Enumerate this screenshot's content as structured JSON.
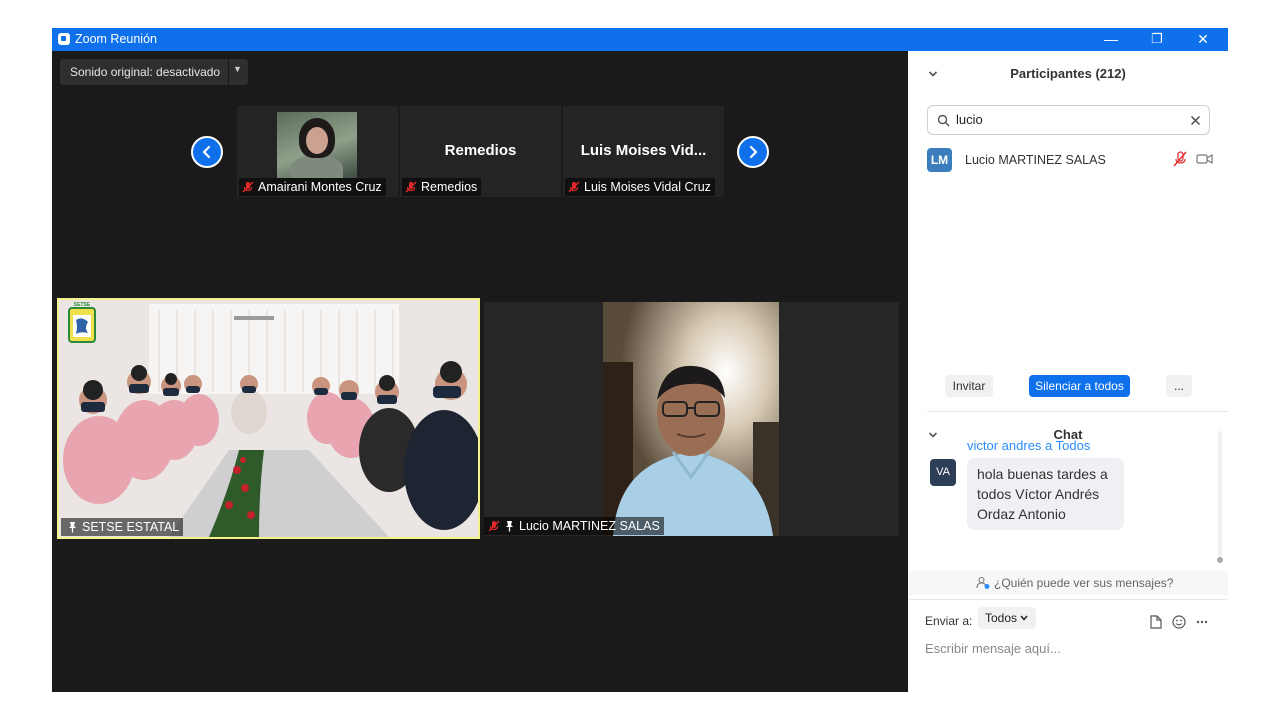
{
  "window": {
    "title": "Zoom Reunión",
    "controls": {
      "minimize": "—",
      "restore": "❐",
      "close": "✕"
    }
  },
  "audio_button": {
    "label": "Sonido original: desactivado",
    "caret": "▼"
  },
  "strip": {
    "tiles": [
      {
        "big_name": "",
        "label": "Amairani Montes Cruz",
        "muted": true,
        "has_photo": true
      },
      {
        "big_name": "Remedios",
        "label": "Remedios",
        "muted": true,
        "has_photo": false
      },
      {
        "big_name": "Luis Moises Vid...",
        "label": "Luis Moises Vidal Cruz",
        "muted": true,
        "has_photo": false
      }
    ]
  },
  "main_tiles": {
    "setse": {
      "label": "SETSE ESTATAL",
      "pinned": true,
      "active_speaker": true,
      "logo_text": "SETSE"
    },
    "lucio": {
      "label": "Lucio MARTINEZ SALAS",
      "pinned": true,
      "muted": true
    }
  },
  "participants": {
    "header": "Participantes (212)",
    "search_value": "lucio",
    "items": [
      {
        "initials": "LM",
        "name": "Lucio MARTINEZ SALAS",
        "muted": true,
        "video_off": true
      }
    ],
    "buttons": {
      "invite": "Invitar",
      "mute_all": "Silenciar a todos",
      "more": "..."
    }
  },
  "chat": {
    "header": "Chat",
    "message": {
      "sender": "victor andres",
      "connector": "a",
      "recipient": "Todos",
      "initials": "VA",
      "text": "hola buenas tardes a todos Víctor Andrés Ordaz Antonio"
    },
    "who_can_see": "¿Quién puede ver sus mensajes?",
    "send_to_label": "Enviar a:",
    "send_to_value": "Todos",
    "input_placeholder": "Escribir mensaje aquí..."
  },
  "colors": {
    "accent": "#0e71eb",
    "link": "#2d8cff",
    "muted": "#e02828",
    "active_border": "#f2f28a",
    "avatar_lm": "#3b7dbd",
    "avatar_va": "#2d3f57"
  }
}
